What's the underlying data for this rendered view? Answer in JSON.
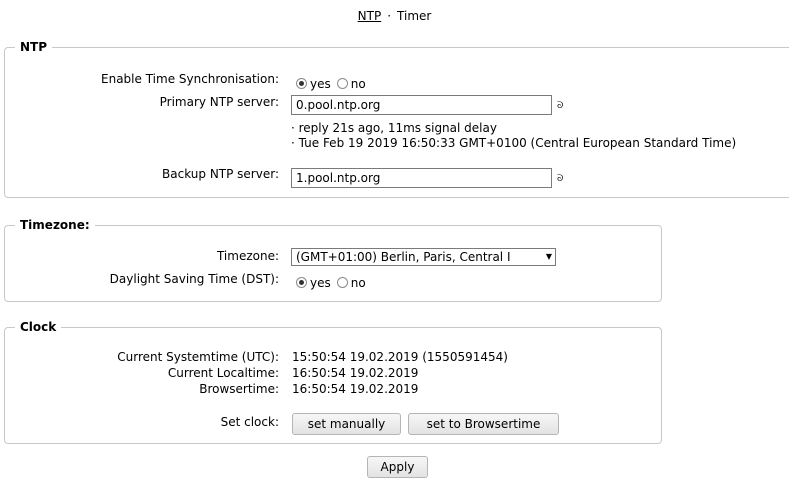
{
  "nav": {
    "ntp_link": "NTP",
    "separator": "·",
    "timer_link": "Timer"
  },
  "ntp": {
    "legend": "NTP",
    "enable_label": "Enable Time Synchronisation:",
    "enable_yes": "yes",
    "enable_no": "no",
    "enable_selected": "yes",
    "primary_label": "Primary NTP server:",
    "primary_value": "0.pool.ntp.org",
    "status_reply": "· reply 21s ago, 11ms signal delay",
    "status_time": "· Tue Feb 19 2019 16:50:33 GMT+0100 (Central European Standard Time)",
    "backup_label": "Backup NTP server:",
    "backup_value": "1.pool.ntp.org",
    "server_icon_glyph": "ᘐ"
  },
  "timezone": {
    "legend": "Timezone:",
    "tz_label": "Timezone:",
    "tz_value": "(GMT+01:00) Berlin, Paris, Central I",
    "dst_label": "Daylight Saving Time (DST):",
    "dst_yes": "yes",
    "dst_no": "no",
    "dst_selected": "yes"
  },
  "clock": {
    "legend": "Clock",
    "systemtime_label": "Current Systemtime (UTC):",
    "systemtime_value": "15:50:54 19.02.2019 (1550591454)",
    "localtime_label": "Current Localtime:",
    "localtime_value": "16:50:54 19.02.2019",
    "browsertime_label": "Browsertime:",
    "browsertime_value": "16:50:54 19.02.2019",
    "setclock_label": "Set clock:",
    "set_manually_button": "set manually",
    "set_browsertime_button": "set to Browsertime"
  },
  "apply_button": "Apply",
  "colors": {
    "border": "#c8c8c8",
    "button_bg": "#e3e3e3"
  }
}
